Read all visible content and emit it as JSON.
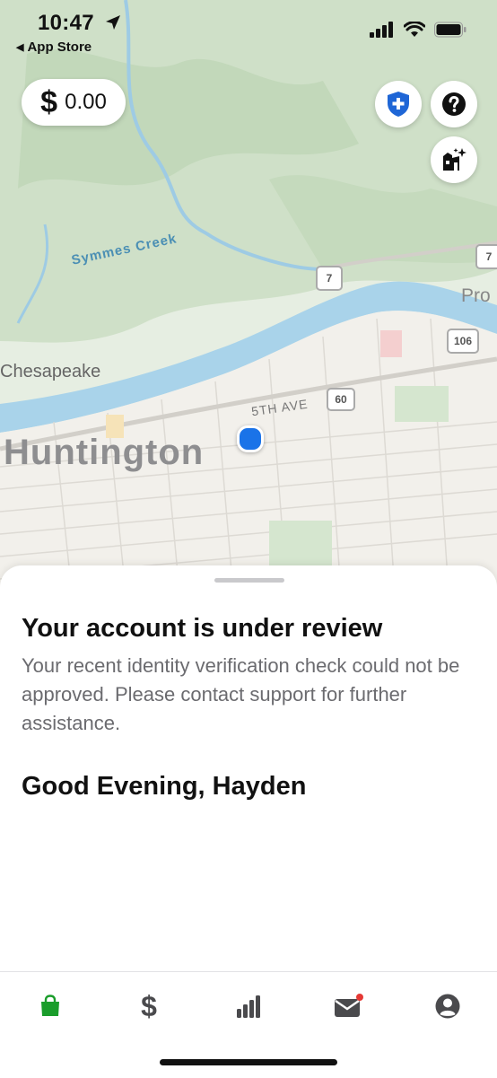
{
  "status_bar": {
    "time": "10:47",
    "back_label": "App Store"
  },
  "map": {
    "labels": {
      "creek": "Symmes Creek",
      "town1": "Chesapeake",
      "city": "Huntington",
      "street": "5TH AVE",
      "partial": "Pro"
    },
    "route_shields": [
      "7",
      "7",
      "60",
      "106"
    ],
    "colors": {
      "land": "#e8efe4",
      "forest": "#c9dcc3",
      "river": "#a9d3ea",
      "city": "#f1efea",
      "user_location": "#1a73e8"
    }
  },
  "controls": {
    "balance_symbol": "$",
    "balance_amount": "0.00",
    "shield_icon_color": "#1f66d6"
  },
  "sheet": {
    "title": "Your account is under review",
    "body": "Your recent identity verification check could not be approved. Please contact support for further assistance.",
    "greeting": "Good Evening, Hayden"
  },
  "tabbar": {
    "tabs": [
      {
        "name": "shop",
        "icon": "shopping-bag-icon",
        "active": true
      },
      {
        "name": "earnings",
        "icon": "dollar-icon",
        "active": false
      },
      {
        "name": "ratings",
        "icon": "bar-chart-icon",
        "active": false
      },
      {
        "name": "inbox",
        "icon": "mail-icon",
        "active": false,
        "badge": true
      },
      {
        "name": "account",
        "icon": "profile-icon",
        "active": false
      }
    ],
    "active_color": "#1a9d2b",
    "inactive_color": "#4a4a4d",
    "badge_color": "#e53935"
  }
}
